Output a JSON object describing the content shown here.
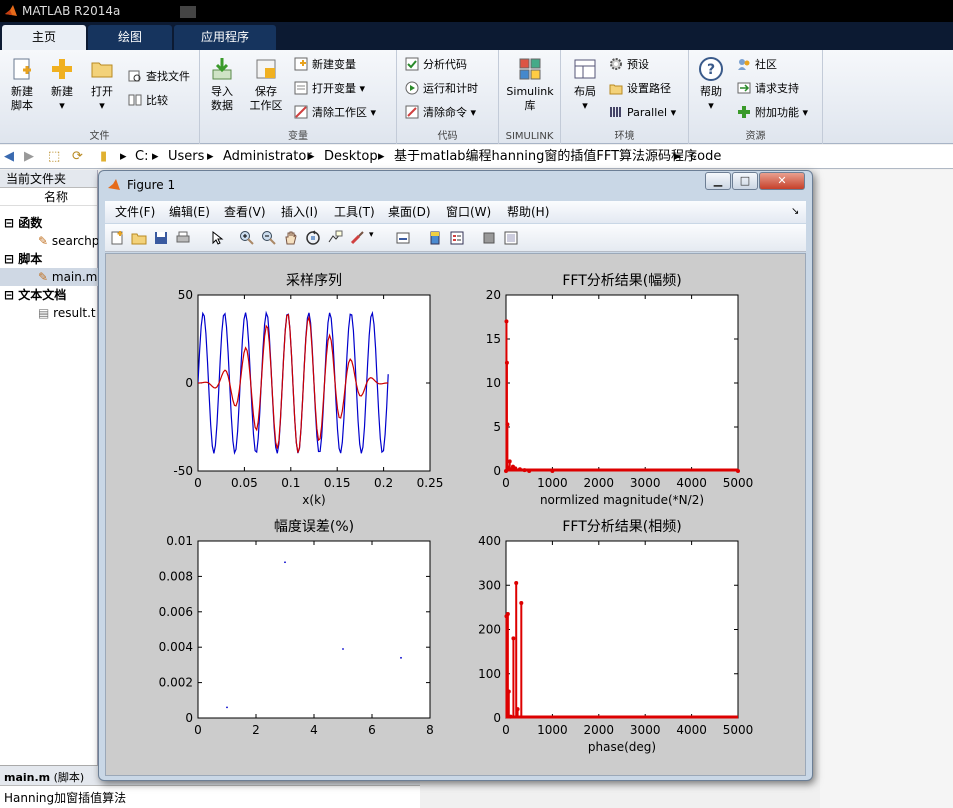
{
  "window": {
    "title": "MATLAB R2014a"
  },
  "tabs": [
    {
      "label": "主页"
    },
    {
      "label": "绘图"
    },
    {
      "label": "应用程序"
    }
  ],
  "ribbon": {
    "file": {
      "new_script": "新建\n脚本",
      "new": "新建",
      "open": "打开",
      "find_files": "查找文件",
      "compare": "比较",
      "label": "文件"
    },
    "variable": {
      "import": "导入\n数据",
      "save": "保存\n工作区",
      "new_var": "新建变量",
      "open_var": "打开变量",
      "clear_ws": "清除工作区",
      "label": "变量"
    },
    "code": {
      "analyze": "分析代码",
      "run_time": "运行和计时",
      "clear_cmd": "清除命令",
      "label": "代码"
    },
    "simulink": {
      "lib": "Simulink\n库",
      "label": "SIMULINK"
    },
    "env": {
      "layout": "布局",
      "prefs": "预设",
      "set_path": "设置路径",
      "parallel": "Parallel",
      "label": "环境"
    },
    "resources": {
      "help": "帮助",
      "community": "社区",
      "support": "请求支持",
      "addons": "附加功能",
      "label": "资源"
    }
  },
  "address": {
    "parts": [
      "C:",
      "Users",
      "Administrator",
      "Desktop",
      "基于matlab编程hanning窗的插值FFT算法源码程序",
      "code"
    ]
  },
  "current_folder": {
    "header": "当前文件夹",
    "col_name": "名称",
    "groups": [
      {
        "label": "函数",
        "items": [
          "searchp"
        ]
      },
      {
        "label": "脚本",
        "items": [
          "main.m"
        ]
      },
      {
        "label": "文本文档",
        "items": [
          "result.t"
        ]
      }
    ]
  },
  "details": {
    "file": "main.m",
    "file_type": "(脚本)",
    "desc": "Hanning加窗插值算法"
  },
  "figure": {
    "title": "Figure 1",
    "menu": [
      "文件(F)",
      "编辑(E)",
      "查看(V)",
      "插入(I)",
      "工具(T)",
      "桌面(D)",
      "窗口(W)",
      "帮助(H)"
    ]
  },
  "chart_data": [
    {
      "type": "line",
      "title": "采样序列",
      "xlabel": "x(k)",
      "ylabel": "",
      "xlim": [
        0,
        0.25
      ],
      "ylim": [
        -50,
        50
      ],
      "xticks": [
        "0",
        "0.05",
        "0.1",
        "0.15",
        "0.2",
        "0.25"
      ],
      "yticks": [
        "-50",
        "0",
        "50"
      ],
      "series": [
        {
          "color": "#0000cc",
          "description": "raw sinusoid samples, amplitude ~40, about 9 cycles over 0–0.205"
        },
        {
          "color": "#cc0000",
          "description": "hanning-windowed samples, envelope peaks ~40 near x=0.1"
        }
      ]
    },
    {
      "type": "line",
      "title": "FFT分析结果(幅频)",
      "xlabel": "normlized magnitude(*N/2)",
      "xlim": [
        0,
        5000
      ],
      "ylim": [
        0,
        20
      ],
      "xticks": [
        "0",
        "1000",
        "2000",
        "3000",
        "4000",
        "5000"
      ],
      "yticks": [
        "0",
        "5",
        "10",
        "15",
        "20"
      ],
      "series": [
        {
          "color": "#dd0000",
          "x": [
            0,
            10,
            20,
            30,
            50,
            80,
            100,
            150,
            200,
            300,
            400,
            500,
            1000,
            5000
          ],
          "y": [
            0,
            17,
            12.3,
            5.3,
            0.4,
            1.1,
            0.2,
            0.5,
            0.3,
            0.2,
            0.1,
            0,
            0,
            0
          ]
        }
      ]
    },
    {
      "type": "scatter",
      "title": "幅度误差(%)",
      "xlim": [
        0,
        8
      ],
      "ylim": [
        0,
        0.01
      ],
      "xticks": [
        "0",
        "2",
        "4",
        "6",
        "8"
      ],
      "yticks": [
        "0",
        "0.002",
        "0.004",
        "0.006",
        "0.008",
        "0.01"
      ],
      "series": [
        {
          "color": "#0000cc",
          "x": [
            1,
            3,
            5,
            7
          ],
          "y": [
            0.0006,
            0.0088,
            0.0039,
            0.0034
          ]
        }
      ]
    },
    {
      "type": "line",
      "title": "FFT分析结果(相频)",
      "xlabel": "phase(deg)",
      "xlim": [
        0,
        5000
      ],
      "ylim": [
        0,
        400
      ],
      "xticks": [
        "0",
        "1000",
        "2000",
        "3000",
        "4000",
        "5000"
      ],
      "yticks": [
        "0",
        "100",
        "200",
        "300",
        "400"
      ],
      "series": [
        {
          "color": "#dd0000",
          "x": [
            10,
            40,
            60,
            100,
            160,
            220,
            250,
            330
          ],
          "y": [
            230,
            235,
            60,
            3,
            180,
            305,
            20,
            260
          ]
        }
      ]
    }
  ]
}
